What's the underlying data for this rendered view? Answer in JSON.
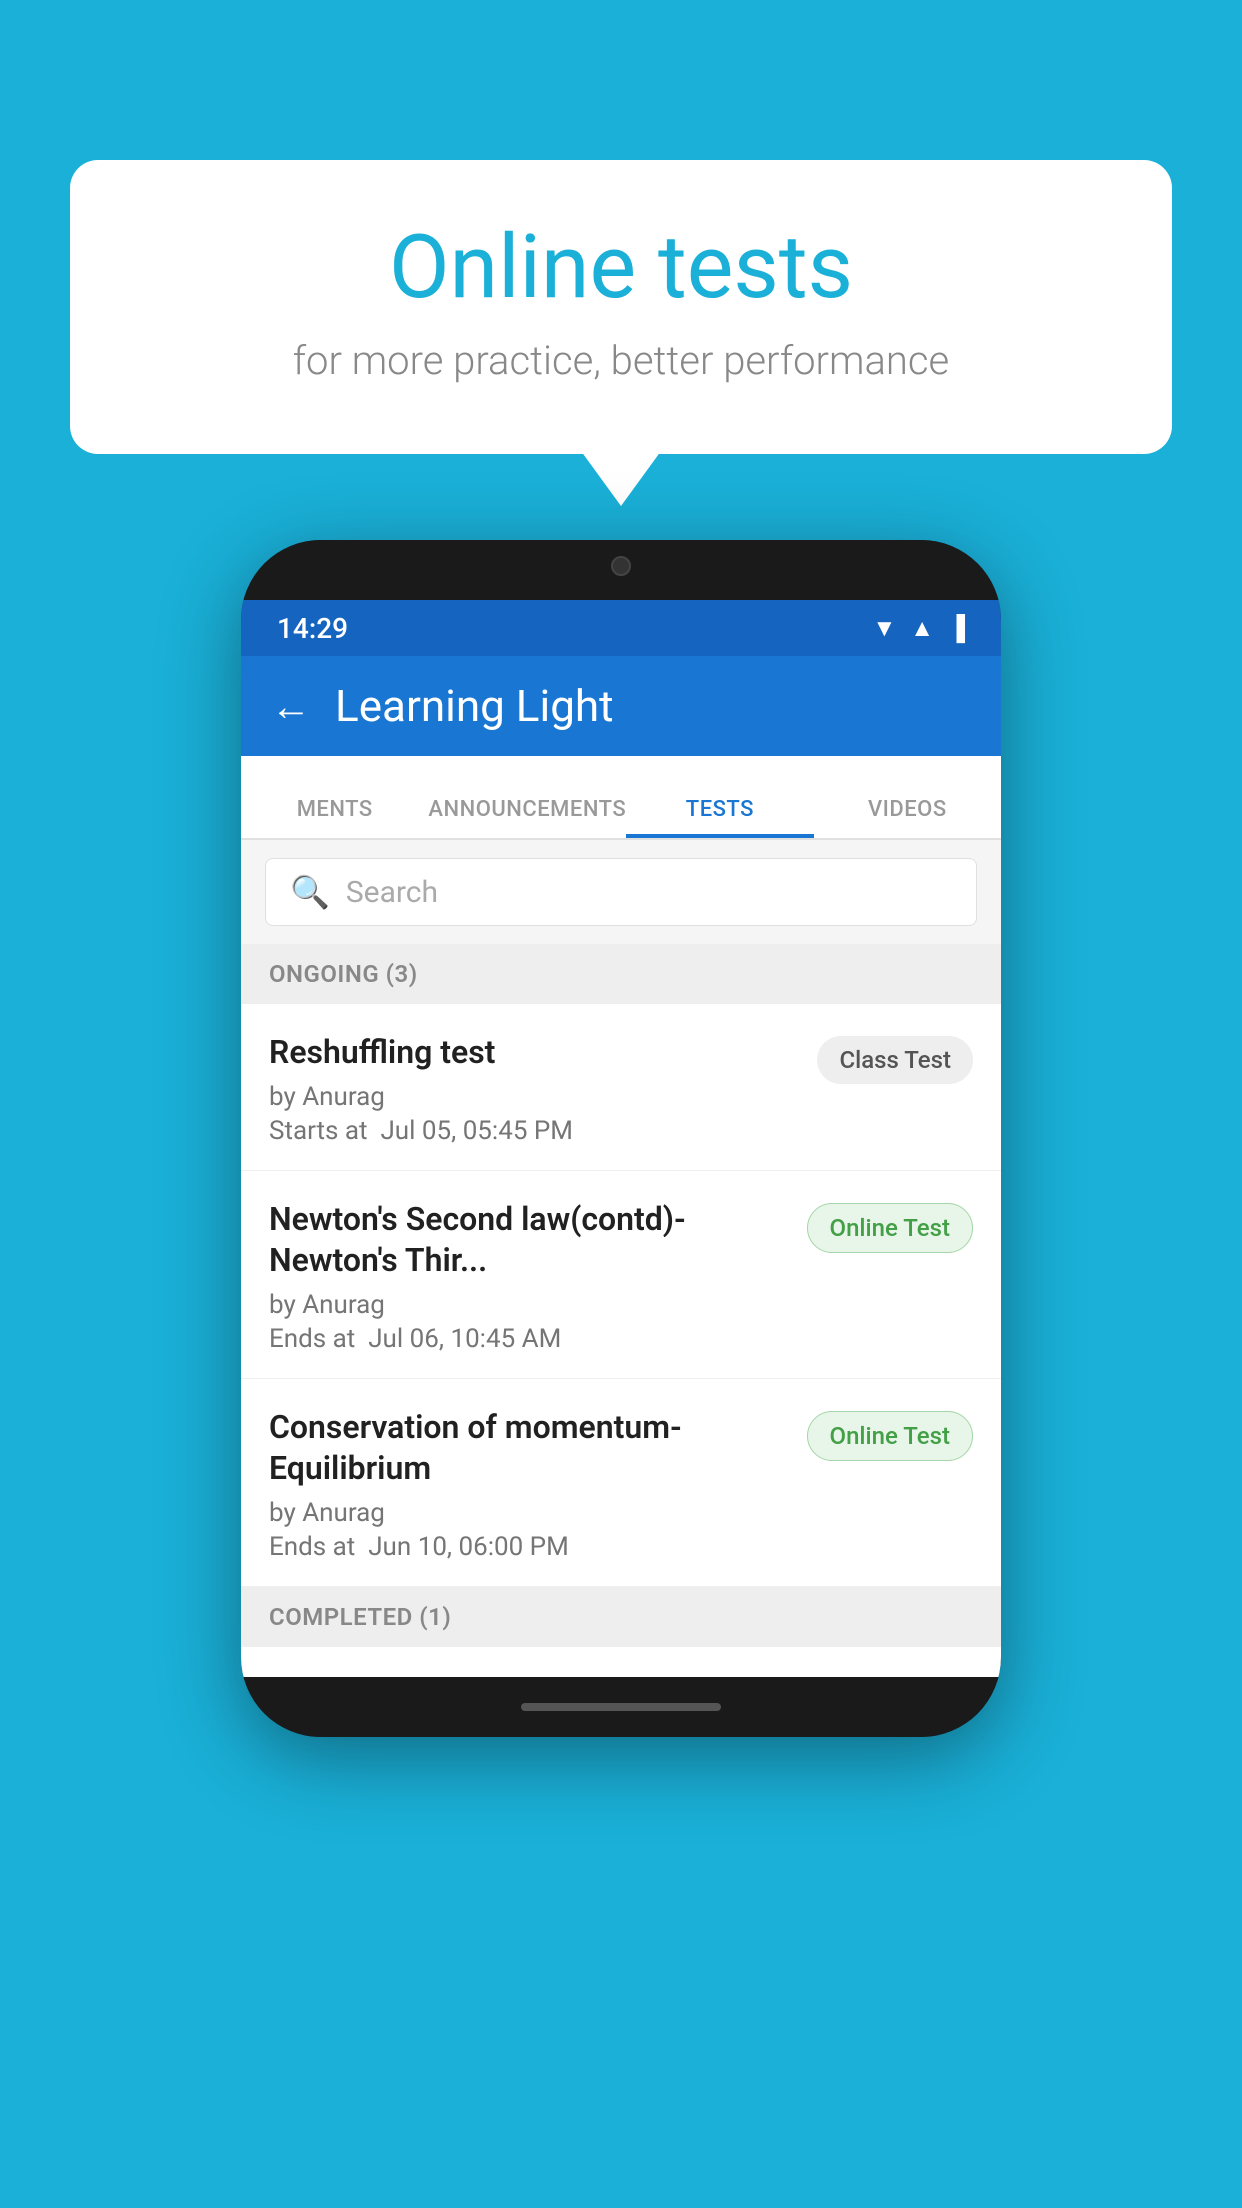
{
  "background_color": "#1ab0d8",
  "bubble": {
    "title": "Online tests",
    "subtitle": "for more practice, better performance"
  },
  "phone": {
    "status_bar": {
      "time": "14:29",
      "icons": [
        "wifi",
        "signal",
        "battery"
      ]
    },
    "app_bar": {
      "title": "Learning Light",
      "back_label": "←"
    },
    "tabs": [
      {
        "label": "MENTS",
        "active": false
      },
      {
        "label": "ANNOUNCEMENTS",
        "active": false
      },
      {
        "label": "TESTS",
        "active": true
      },
      {
        "label": "VIDEOS",
        "active": false
      }
    ],
    "search": {
      "placeholder": "Search"
    },
    "section_ongoing": "ONGOING (3)",
    "tests": [
      {
        "title": "Reshuffling test",
        "author": "by Anurag",
        "date": "Starts at  Jul 05, 05:45 PM",
        "badge": "Class Test",
        "badge_type": "class"
      },
      {
        "title": "Newton's Second law(contd)-Newton's Thir...",
        "author": "by Anurag",
        "date": "Ends at  Jul 06, 10:45 AM",
        "badge": "Online Test",
        "badge_type": "online"
      },
      {
        "title": "Conservation of momentum-Equilibrium",
        "author": "by Anurag",
        "date": "Ends at  Jun 10, 06:00 PM",
        "badge": "Online Test",
        "badge_type": "online"
      }
    ],
    "section_completed": "COMPLETED (1)"
  }
}
